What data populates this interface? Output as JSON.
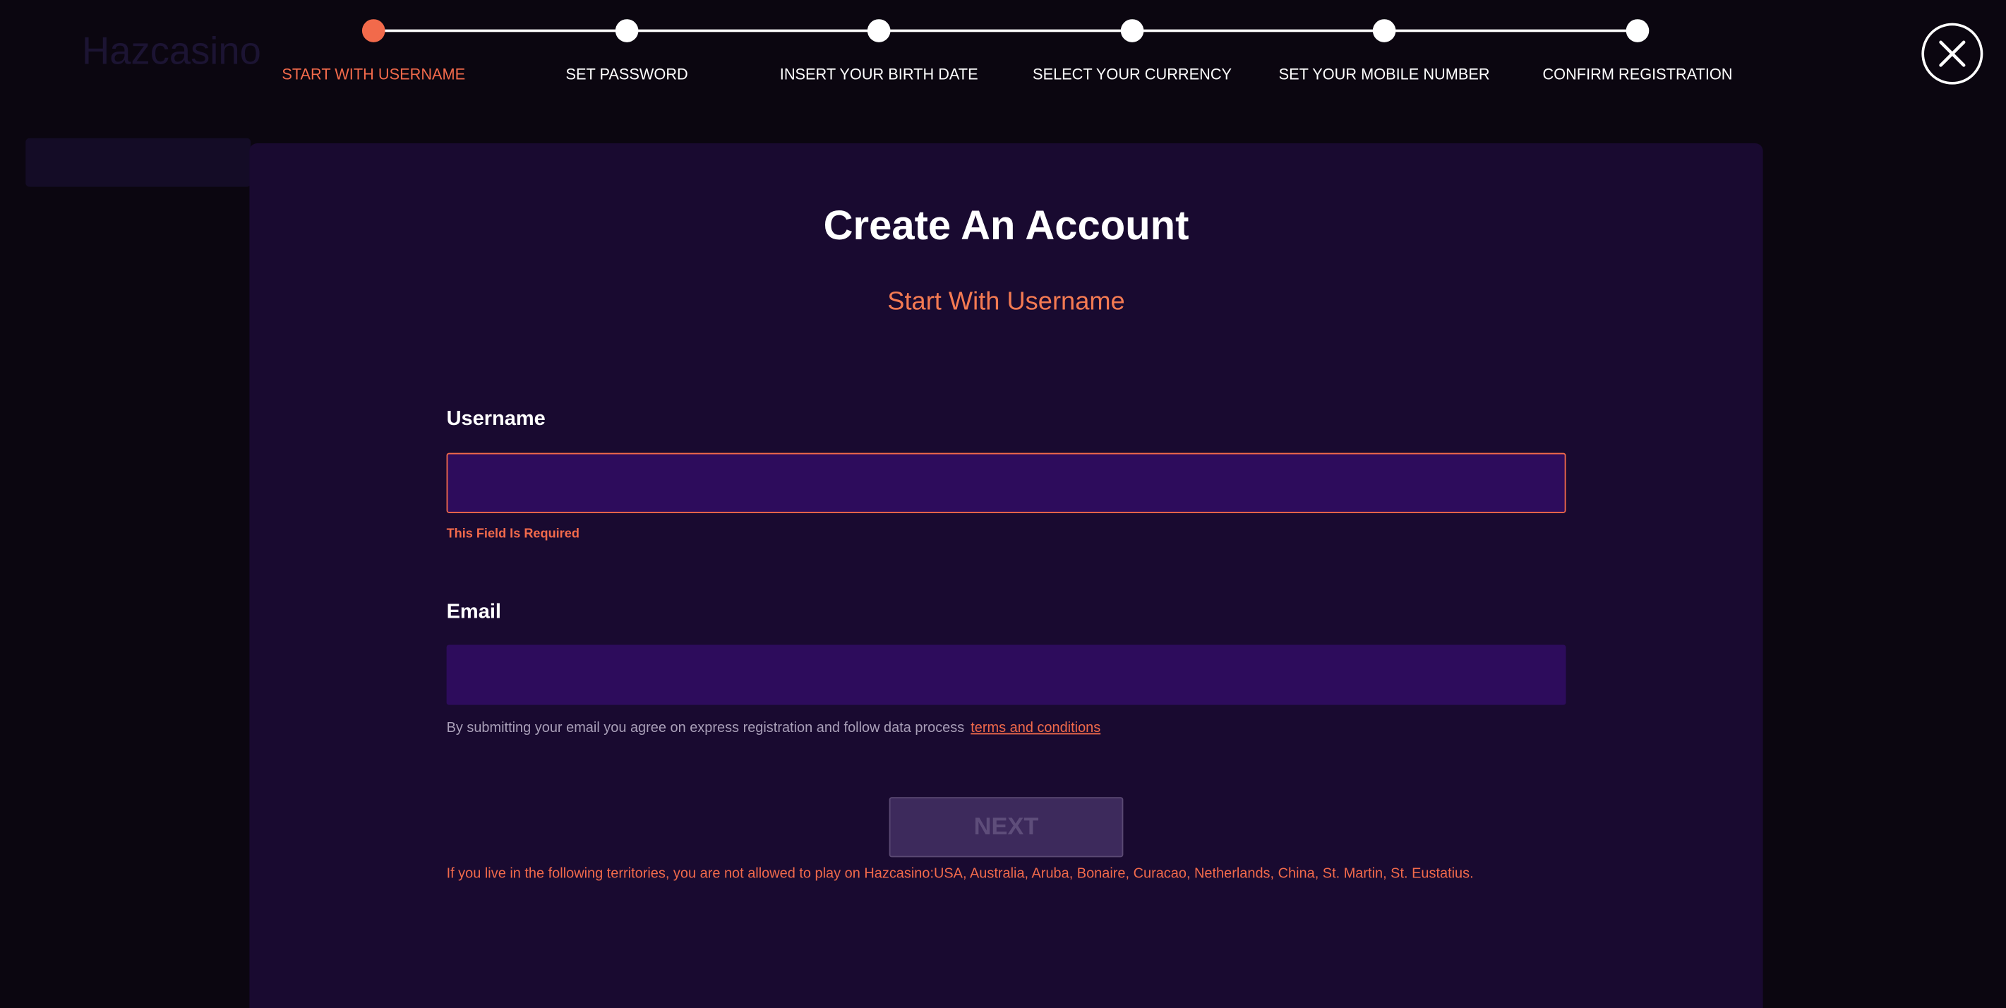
{
  "background": {
    "logo_text": "Hazcasino"
  },
  "stepper": {
    "steps": [
      {
        "label": "START WITH USERNAME",
        "active": true
      },
      {
        "label": "SET PASSWORD",
        "active": false
      },
      {
        "label": "INSERT YOUR BIRTH DATE",
        "active": false
      },
      {
        "label": "SELECT YOUR CURRENCY",
        "active": false
      },
      {
        "label": "SET YOUR MOBILE NUMBER",
        "active": false
      },
      {
        "label": "CONFIRM REGISTRATION",
        "active": false
      }
    ],
    "current_step": 1,
    "total_steps": 6
  },
  "close_icon": "close-icon",
  "modal": {
    "title": "Create An Account",
    "subtitle": "Start With Username",
    "username": {
      "label": "Username",
      "value": "",
      "placeholder": "",
      "error": "This Field Is Required"
    },
    "email": {
      "label": "Email",
      "value": "",
      "placeholder": ""
    },
    "email_note": "By submitting your email you agree on express registration and follow data process",
    "terms_link": "terms and conditions",
    "next_label": "NEXT",
    "next_disabled": true,
    "territories_notice": "If you live in the following territories, you are not allowed to play on Hazcasino:USA, Australia, Aruba, Bonaire, Curacao, Netherlands, China, St. Martin, St. Eustatius."
  },
  "colors": {
    "accent": "#f26a4b",
    "modal_bg": "#190a30",
    "input_bg": "#2d0c5c",
    "page_bg": "#0b0610"
  }
}
